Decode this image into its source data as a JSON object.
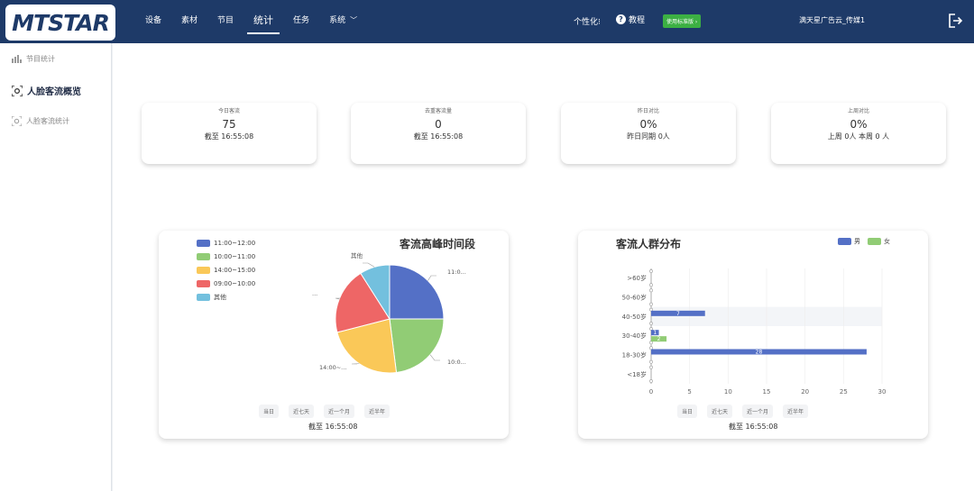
{
  "app": {
    "logo_text": "MTSTAR"
  },
  "nav": {
    "items": [
      {
        "label": "设备"
      },
      {
        "label": "素材"
      },
      {
        "label": "节目"
      },
      {
        "label": "统计"
      },
      {
        "label": "任务"
      },
      {
        "label": "系统"
      }
    ],
    "active": "统计"
  },
  "header": {
    "personalize": "个性化⁝",
    "help": "教程",
    "edition_badge": "使用标准版 ›",
    "company": "满天星广告云_传媒1"
  },
  "sidebar": {
    "items": [
      {
        "label": "节目统计",
        "icon": "bar-chart-icon"
      },
      {
        "label": "人脸客流概览",
        "icon": "face-scan-icon"
      },
      {
        "label": "人脸客流统计",
        "icon": "face-scan-icon"
      }
    ],
    "active_index": 1
  },
  "stats": [
    {
      "label": "今日客流",
      "value": "75",
      "sub": "截至 16:55:08"
    },
    {
      "label": "去重客流量",
      "value": "0",
      "sub": "截至 16:55:08"
    },
    {
      "label": "昨日对比",
      "value": "0%",
      "sub": "昨日同期 0人"
    },
    {
      "label": "上周对比",
      "value": "0%",
      "sub": "上周 0人 本周 0 人"
    }
  ],
  "pie_card": {
    "title": "客流高峰时间段",
    "range_buttons": [
      "当日",
      "近七天",
      "近一个月",
      "近半年"
    ],
    "asof": "截至 16:55:08",
    "legend": [
      {
        "label": "11:00~12:00",
        "color": "#5470c6"
      },
      {
        "label": "10:00~11:00",
        "color": "#91cc75"
      },
      {
        "label": "14:00~15:00",
        "color": "#fac858"
      },
      {
        "label": "09:00~10:00",
        "color": "#ee6666"
      },
      {
        "label": "其他",
        "color": "#73c0de"
      }
    ],
    "slice_labels": [
      "11:0...",
      "10:0...",
      "14:00~...",
      "...",
      "其他"
    ]
  },
  "bar_card": {
    "title": "客流人群分布",
    "range_buttons": [
      "当日",
      "近七天",
      "近一个月",
      "近半年"
    ],
    "asof": "截至 16:55:08",
    "legend": [
      {
        "label": "男",
        "color": "#5470c6"
      },
      {
        "label": "女",
        "color": "#91cc75"
      }
    ]
  },
  "chart_data": [
    {
      "type": "pie",
      "title": "客流高峰时间段",
      "categories": [
        "11:00~12:00",
        "10:00~11:00",
        "14:00~15:00",
        "09:00~10:00",
        "其他"
      ],
      "values": [
        25,
        23,
        23,
        20,
        9
      ]
    },
    {
      "type": "bar",
      "orientation": "horizontal",
      "title": "客流人群分布",
      "categories": [
        "<18岁",
        "18-30岁",
        "30-40岁",
        "40-50岁",
        "50-60岁",
        ">60岁"
      ],
      "series": [
        {
          "name": "男",
          "values": [
            0,
            28,
            1,
            7,
            0,
            0
          ]
        },
        {
          "name": "女",
          "values": [
            0,
            0,
            2,
            0,
            0,
            0
          ]
        }
      ],
      "xlim": [
        0,
        30
      ],
      "xticks": [
        0,
        5,
        10,
        15,
        20,
        25,
        30
      ]
    }
  ]
}
